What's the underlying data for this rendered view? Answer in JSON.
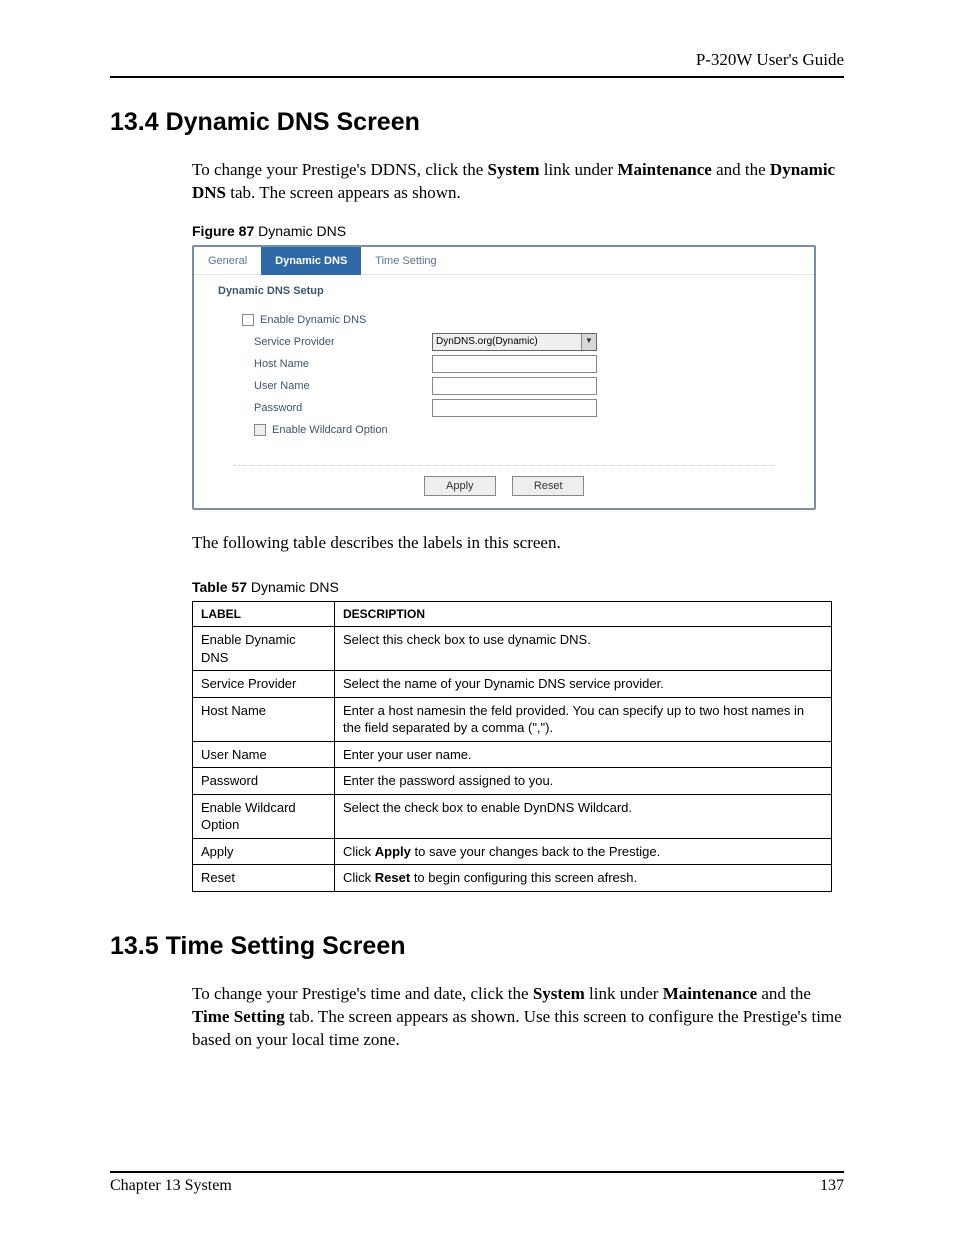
{
  "header": {
    "guide": "P-320W User's Guide"
  },
  "section134": {
    "title": "13.4  Dynamic DNS Screen",
    "para_parts": [
      "To change your Prestige's DDNS, click the ",
      "System",
      " link under ",
      "Maintenance",
      " and the ",
      "Dynamic DNS",
      " tab. The screen appears as shown."
    ]
  },
  "figure": {
    "caption_bold": "Figure 87",
    "caption_rest": "   Dynamic DNS",
    "tabs": {
      "general": "General",
      "dynamic_dns": "Dynamic DNS",
      "time_setting": "Time Setting"
    },
    "section_title": "Dynamic DNS Setup",
    "labels": {
      "enable_ddns": "Enable Dynamic DNS",
      "service_provider": "Service Provider",
      "host_name": "Host Name",
      "user_name": "User Name",
      "password": "Password",
      "enable_wildcard": "Enable Wildcard Option"
    },
    "select_value": "DynDNS.org(Dynamic)",
    "buttons": {
      "apply": "Apply",
      "reset": "Reset"
    }
  },
  "table_intro": "The following table describes the labels in this screen.",
  "table": {
    "caption_bold": "Table 57",
    "caption_rest": "   Dynamic DNS",
    "head": {
      "label": "Label",
      "desc": "Description"
    },
    "rows": [
      {
        "label": "Enable Dynamic DNS",
        "desc": "Select this check box to use dynamic DNS."
      },
      {
        "label": "Service Provider",
        "desc": "Select the name of your Dynamic DNS service provider."
      },
      {
        "label": "Host Name",
        "desc": "Enter a host namesin the feld provided. You can specify up to two host names in the field separated by a comma (\",\")."
      },
      {
        "label": "User Name",
        "desc": "Enter your user name."
      },
      {
        "label": "Password",
        "desc": "Enter the password assigned to you."
      },
      {
        "label": "Enable Wildcard Option",
        "desc": "Select the check box to enable DynDNS Wildcard."
      },
      {
        "label": "Apply",
        "desc_pre": "Click ",
        "desc_bold": "Apply",
        "desc_post": " to save your changes back to the Prestige."
      },
      {
        "label": "Reset",
        "desc_pre": "Click ",
        "desc_bold": "Reset",
        "desc_post": " to begin configuring this screen afresh."
      }
    ]
  },
  "section135": {
    "title": "13.5  Time Setting Screen",
    "para_parts": [
      "To change your Prestige's time and date, click the ",
      "System",
      " link under ",
      "Maintenance",
      " and the ",
      "Time Setting",
      " tab. The screen appears as shown. Use this screen to configure the Prestige's time based on your local time zone."
    ]
  },
  "footer": {
    "left": "Chapter 13 System",
    "right": "137"
  }
}
